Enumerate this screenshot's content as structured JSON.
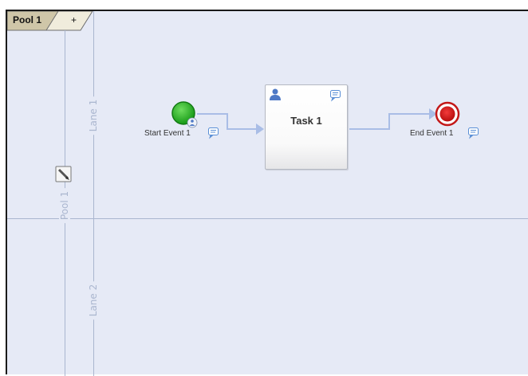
{
  "tabs": [
    {
      "label": "Pool 1",
      "active": true
    },
    {
      "label": "+",
      "active": false
    }
  ],
  "pool": {
    "label": "Pool 1"
  },
  "lanes": [
    {
      "label": "Lane 1"
    },
    {
      "label": "Lane 2"
    }
  ],
  "start_event": {
    "label": "Start Event 1",
    "color": "#2ea52e"
  },
  "task": {
    "label": "Task 1"
  },
  "end_event": {
    "label": "End Event 1",
    "color": "#d11616"
  },
  "colors": {
    "canvas": "#e6eaf6",
    "lane_lines": "#aab6cf",
    "connector": "#a9bde6",
    "comment_icon": "#5a8fd6"
  }
}
